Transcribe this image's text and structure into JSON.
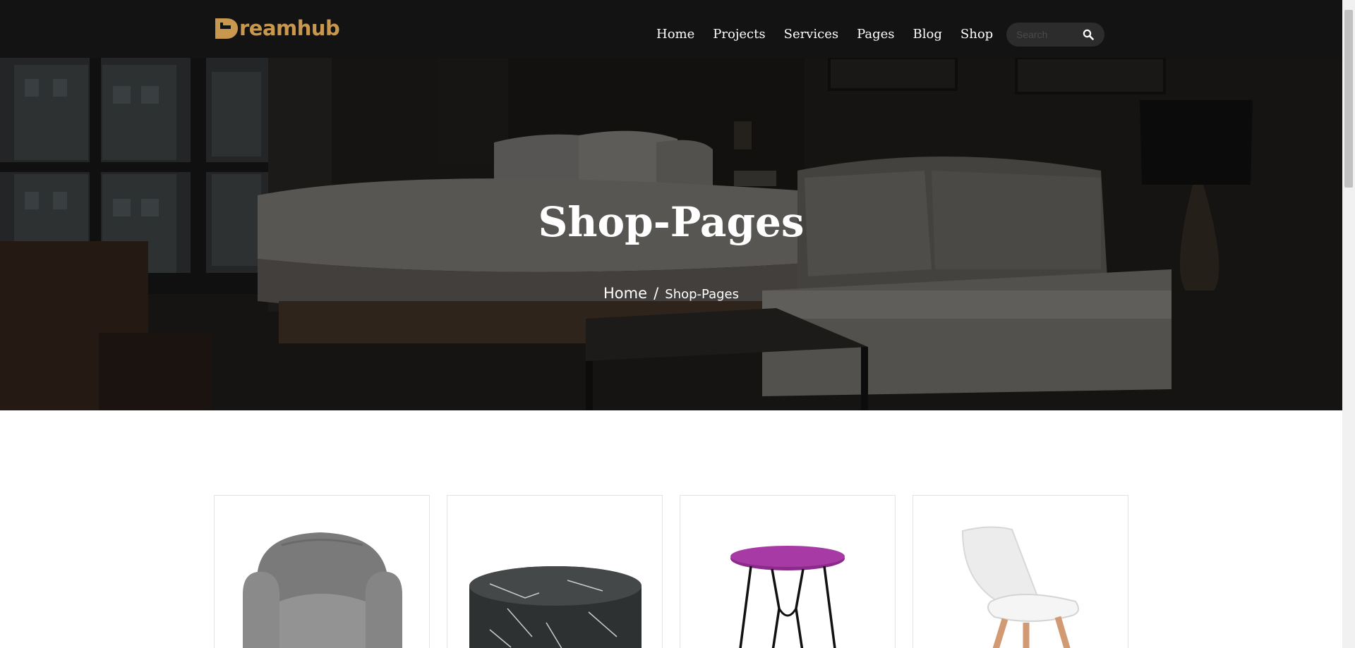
{
  "brand": {
    "name": "reamhub",
    "color": "#c9984f"
  },
  "nav": {
    "items": [
      {
        "label": "Home"
      },
      {
        "label": "Projects"
      },
      {
        "label": "Services"
      },
      {
        "label": "Pages"
      },
      {
        "label": "Blog"
      },
      {
        "label": "Shop"
      }
    ]
  },
  "search": {
    "placeholder": "Search",
    "icon": "search-icon"
  },
  "hero": {
    "title": "Shop-Pages",
    "breadcrumb": {
      "home": "Home",
      "separator": "/",
      "current": "Shop-Pages"
    }
  },
  "products": [
    {
      "image": "grey-armchair"
    },
    {
      "image": "marble-drum-side-table"
    },
    {
      "image": "purple-hairpin-side-table"
    },
    {
      "image": "white-dining-chair"
    }
  ],
  "colors": {
    "header_bg": "#131313",
    "accent": "#c9984f",
    "text_light": "#ffffff"
  }
}
